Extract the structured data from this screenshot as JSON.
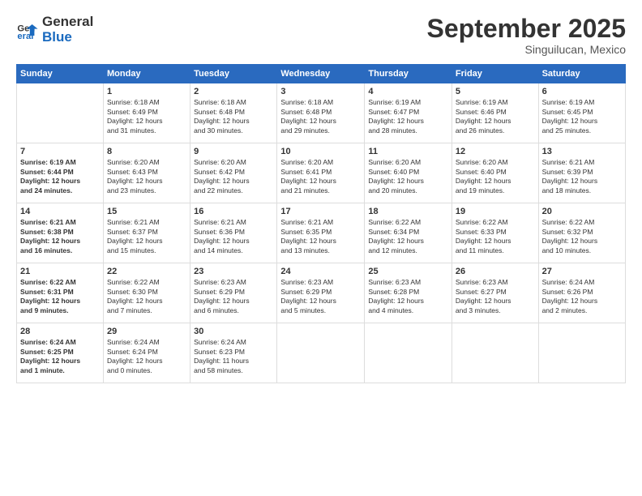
{
  "header": {
    "logo_line1": "General",
    "logo_line2": "Blue",
    "month": "September 2025",
    "location": "Singuilucan, Mexico"
  },
  "columns": [
    "Sunday",
    "Monday",
    "Tuesday",
    "Wednesday",
    "Thursday",
    "Friday",
    "Saturday"
  ],
  "rows": [
    [
      {
        "num": "",
        "info": ""
      },
      {
        "num": "1",
        "info": "Sunrise: 6:18 AM\nSunset: 6:49 PM\nDaylight: 12 hours\nand 31 minutes."
      },
      {
        "num": "2",
        "info": "Sunrise: 6:18 AM\nSunset: 6:48 PM\nDaylight: 12 hours\nand 30 minutes."
      },
      {
        "num": "3",
        "info": "Sunrise: 6:18 AM\nSunset: 6:48 PM\nDaylight: 12 hours\nand 29 minutes."
      },
      {
        "num": "4",
        "info": "Sunrise: 6:19 AM\nSunset: 6:47 PM\nDaylight: 12 hours\nand 28 minutes."
      },
      {
        "num": "5",
        "info": "Sunrise: 6:19 AM\nSunset: 6:46 PM\nDaylight: 12 hours\nand 26 minutes."
      },
      {
        "num": "6",
        "info": "Sunrise: 6:19 AM\nSunset: 6:45 PM\nDaylight: 12 hours\nand 25 minutes."
      }
    ],
    [
      {
        "num": "7",
        "info": "Sunrise: 6:19 AM\nSunset: 6:44 PM\nDaylight: 12 hours\nand 24 minutes."
      },
      {
        "num": "8",
        "info": "Sunrise: 6:20 AM\nSunset: 6:43 PM\nDaylight: 12 hours\nand 23 minutes."
      },
      {
        "num": "9",
        "info": "Sunrise: 6:20 AM\nSunset: 6:42 PM\nDaylight: 12 hours\nand 22 minutes."
      },
      {
        "num": "10",
        "info": "Sunrise: 6:20 AM\nSunset: 6:41 PM\nDaylight: 12 hours\nand 21 minutes."
      },
      {
        "num": "11",
        "info": "Sunrise: 6:20 AM\nSunset: 6:40 PM\nDaylight: 12 hours\nand 20 minutes."
      },
      {
        "num": "12",
        "info": "Sunrise: 6:20 AM\nSunset: 6:40 PM\nDaylight: 12 hours\nand 19 minutes."
      },
      {
        "num": "13",
        "info": "Sunrise: 6:21 AM\nSunset: 6:39 PM\nDaylight: 12 hours\nand 18 minutes."
      }
    ],
    [
      {
        "num": "14",
        "info": "Sunrise: 6:21 AM\nSunset: 6:38 PM\nDaylight: 12 hours\nand 16 minutes."
      },
      {
        "num": "15",
        "info": "Sunrise: 6:21 AM\nSunset: 6:37 PM\nDaylight: 12 hours\nand 15 minutes."
      },
      {
        "num": "16",
        "info": "Sunrise: 6:21 AM\nSunset: 6:36 PM\nDaylight: 12 hours\nand 14 minutes."
      },
      {
        "num": "17",
        "info": "Sunrise: 6:21 AM\nSunset: 6:35 PM\nDaylight: 12 hours\nand 13 minutes."
      },
      {
        "num": "18",
        "info": "Sunrise: 6:22 AM\nSunset: 6:34 PM\nDaylight: 12 hours\nand 12 minutes."
      },
      {
        "num": "19",
        "info": "Sunrise: 6:22 AM\nSunset: 6:33 PM\nDaylight: 12 hours\nand 11 minutes."
      },
      {
        "num": "20",
        "info": "Sunrise: 6:22 AM\nSunset: 6:32 PM\nDaylight: 12 hours\nand 10 minutes."
      }
    ],
    [
      {
        "num": "21",
        "info": "Sunrise: 6:22 AM\nSunset: 6:31 PM\nDaylight: 12 hours\nand 9 minutes."
      },
      {
        "num": "22",
        "info": "Sunrise: 6:22 AM\nSunset: 6:30 PM\nDaylight: 12 hours\nand 7 minutes."
      },
      {
        "num": "23",
        "info": "Sunrise: 6:23 AM\nSunset: 6:29 PM\nDaylight: 12 hours\nand 6 minutes."
      },
      {
        "num": "24",
        "info": "Sunrise: 6:23 AM\nSunset: 6:29 PM\nDaylight: 12 hours\nand 5 minutes."
      },
      {
        "num": "25",
        "info": "Sunrise: 6:23 AM\nSunset: 6:28 PM\nDaylight: 12 hours\nand 4 minutes."
      },
      {
        "num": "26",
        "info": "Sunrise: 6:23 AM\nSunset: 6:27 PM\nDaylight: 12 hours\nand 3 minutes."
      },
      {
        "num": "27",
        "info": "Sunrise: 6:24 AM\nSunset: 6:26 PM\nDaylight: 12 hours\nand 2 minutes."
      }
    ],
    [
      {
        "num": "28",
        "info": "Sunrise: 6:24 AM\nSunset: 6:25 PM\nDaylight: 12 hours\nand 1 minute."
      },
      {
        "num": "29",
        "info": "Sunrise: 6:24 AM\nSunset: 6:24 PM\nDaylight: 12 hours\nand 0 minutes."
      },
      {
        "num": "30",
        "info": "Sunrise: 6:24 AM\nSunset: 6:23 PM\nDaylight: 11 hours\nand 58 minutes."
      },
      {
        "num": "",
        "info": ""
      },
      {
        "num": "",
        "info": ""
      },
      {
        "num": "",
        "info": ""
      },
      {
        "num": "",
        "info": ""
      }
    ]
  ]
}
